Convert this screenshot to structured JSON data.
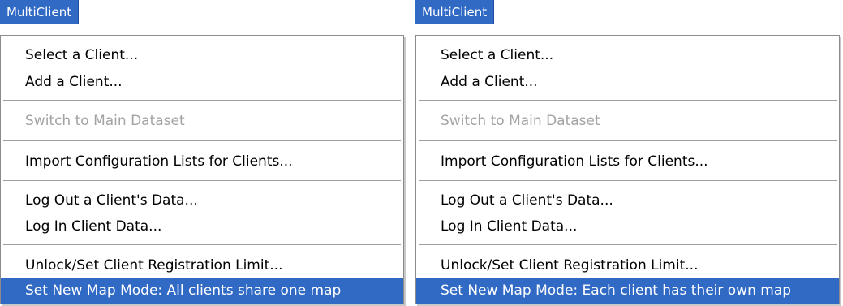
{
  "panels": [
    {
      "title": "MultiClient",
      "items": [
        "Select a Client...",
        "Add a Client...",
        "Switch to Main Dataset",
        "Import Configuration Lists for Clients...",
        "Log Out a Client's Data...",
        "Log In Client Data...",
        "Unlock/Set Client Registration Limit...",
        "Set New Map Mode: All clients share one map"
      ]
    },
    {
      "title": "MultiClient",
      "items": [
        "Select a Client...",
        "Add a Client...",
        "Switch to Main Dataset",
        "Import Configuration Lists for Clients...",
        "Log Out a Client's Data...",
        "Log In Client Data...",
        "Unlock/Set Client Registration Limit...",
        "Set New Map Mode: Each client has their own map"
      ]
    }
  ],
  "colors": {
    "highlight": "#316ac5",
    "disabled_text": "#a3a3a3",
    "menu_border": "#8c8c8c"
  }
}
